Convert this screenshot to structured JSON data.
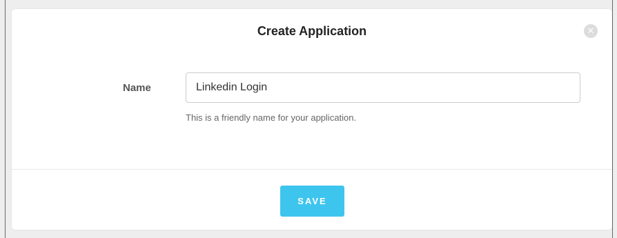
{
  "modal": {
    "title": "Create Application",
    "close_icon": "close-icon"
  },
  "form": {
    "name_label": "Name",
    "name_value": "Linkedin Login",
    "name_help": "This is a friendly name for your application."
  },
  "footer": {
    "save_label": "SAVE",
    "save_color": "#3ec5ee"
  }
}
